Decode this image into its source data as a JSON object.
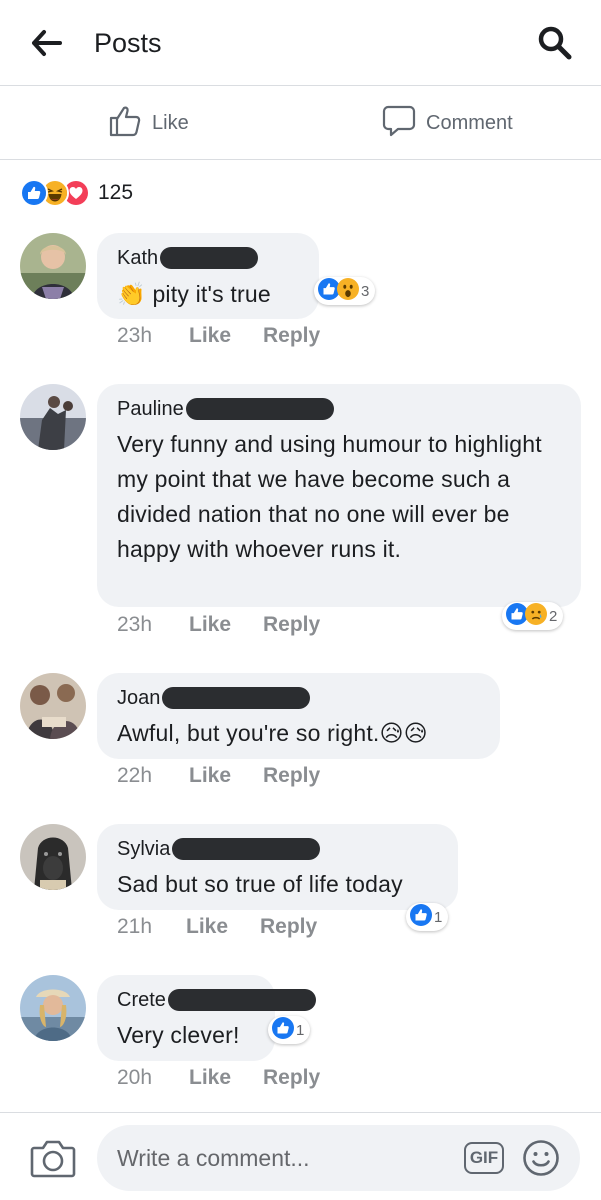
{
  "header": {
    "title": "Posts",
    "back_icon": "back-arrow-icon",
    "search_icon": "search-icon"
  },
  "actions": {
    "like_label": "Like",
    "comment_label": "Comment"
  },
  "reactions_summary": {
    "count": "125",
    "types": [
      "like",
      "haha",
      "love"
    ]
  },
  "comments": [
    {
      "author": "Kath",
      "text": "pity it's true",
      "prefix_emoji": "👏",
      "time": "23h",
      "like_label": "Like",
      "reply_label": "Reply",
      "reaction_count": "3",
      "reaction_types": [
        "like",
        "wow"
      ]
    },
    {
      "author": "Pauline",
      "text": "Very funny and using humour to highlight my point that we have become such a divided nation that no one will ever be happy with whoever runs it.",
      "time": "23h",
      "like_label": "Like",
      "reply_label": "Reply",
      "reaction_count": "2",
      "reaction_types": [
        "like",
        "sad"
      ]
    },
    {
      "author": "Joan",
      "text": "Awful, but you're so right.",
      "suffix_emoji": "😥😥",
      "time": "22h",
      "like_label": "Like",
      "reply_label": "Reply"
    },
    {
      "author": "Sylvia",
      "text": "Sad but so true of life today",
      "time": "21h",
      "like_label": "Like",
      "reply_label": "Reply",
      "reaction_count": "1",
      "reaction_types": [
        "like"
      ]
    },
    {
      "author": "Crete",
      "text": "Very clever!",
      "time": "20h",
      "like_label": "Like",
      "reply_label": "Reply",
      "reaction_count": "1",
      "reaction_types": [
        "like"
      ]
    }
  ],
  "composer": {
    "placeholder": "Write a comment...",
    "gif_label": "GIF",
    "camera_icon": "camera-icon",
    "emoji_icon": "smiley-icon"
  },
  "colors": {
    "like_blue": "#1877f2",
    "love_red": "#f33e58",
    "haha_yellow": "#f7b125",
    "bubble_bg": "#f0f2f5",
    "meta_gray": "#8a8d91",
    "redaction": "#2b2d30"
  }
}
